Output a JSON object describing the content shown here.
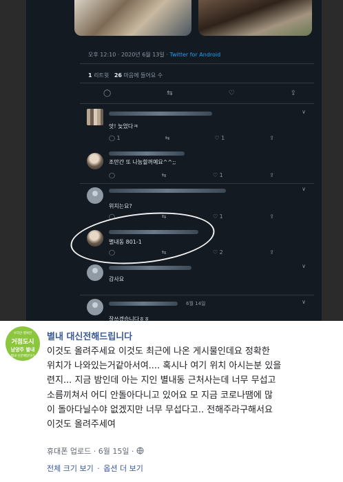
{
  "tweet": {
    "timestamp": "오후 12:10 · 2020년 6월 13일 · ",
    "client": "Twitter for Android",
    "retweet_count": "1",
    "retweet_label": "리트윗",
    "like_count": "26",
    "like_label": "마음에 들어요 수"
  },
  "replies": [
    {
      "text": "앗! 늦었다ㅋ",
      "count_retweet": "1",
      "count_like": "1"
    },
    {
      "text": "조만간 또 나눔할꺼예요^^;;",
      "count_retweet": "",
      "count_like": "1"
    },
    {
      "text": "위치는요?",
      "count_retweet": "",
      "count_like": "1"
    },
    {
      "text": "별내동 801-1",
      "count_retweet": "",
      "count_like": "2"
    },
    {
      "text": "감사요",
      "count_retweet": "",
      "count_like": ""
    },
    {
      "text": "잘쓰겠습니다ㅎㅎ",
      "date": "6월 14일"
    }
  ],
  "post": {
    "logo": {
      "line1": "우리만 행복한",
      "line2": "거점도시",
      "line3": "남양주 별내",
      "line4": "별내 신문배달하기"
    },
    "page_name": "별내 대신전해드립니다",
    "body_lines": [
      "이것도 올려주세요 이것도 최근에 나온 게시물인데요 정확한",
      "위치가 나와있는거같아서여.... 혹시나 여기 위치 아시는분 있을",
      "련지... 지금 밤인데 아는 지인 별내동 근처사는데 너무 무섭고",
      "소름끼쳐서 어디 안돌아다니고 있어요 모 지금 코로나땜에 많",
      "이 돌아다닐수야 없겠지만 너무 무섭다고.. 전해주라구해서요",
      "이것도 올려주세여"
    ],
    "byline": "휴대폰 업로드 · 6월 15일 · ",
    "globe_icon": "globe-icon",
    "link_full": "전체 크기 보기",
    "link_sep": " · ",
    "link_options": "옵션 더 보기"
  },
  "colors": {
    "twitter_bg": "#141a22",
    "twitter_link": "#1da1f2",
    "fb_link": "#385898",
    "logo_green": "#8cc63f"
  }
}
